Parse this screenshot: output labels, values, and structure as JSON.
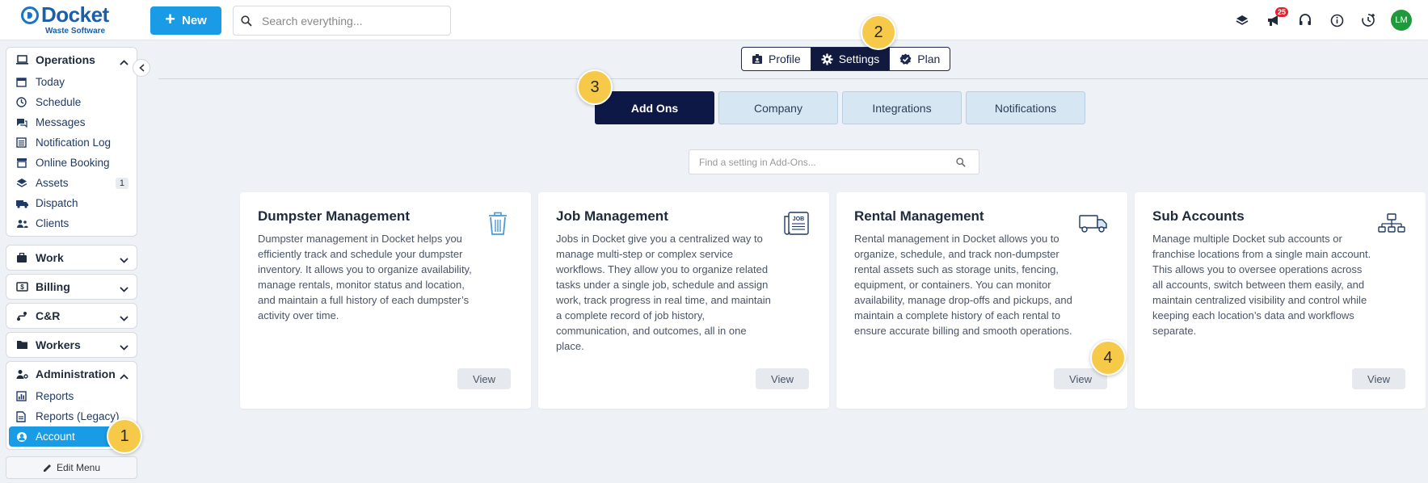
{
  "brand": {
    "name": "Docket",
    "tagline": "Waste Software"
  },
  "header": {
    "new_label": "New",
    "search_placeholder": "Search everything...",
    "notification_count": "25",
    "avatar_initials": "LM"
  },
  "sidebar": {
    "operations": {
      "label": "Operations",
      "items": [
        {
          "label": "Today"
        },
        {
          "label": "Schedule"
        },
        {
          "label": "Messages"
        },
        {
          "label": "Notification Log"
        },
        {
          "label": "Online Booking"
        },
        {
          "label": "Assets",
          "badge": "1"
        },
        {
          "label": "Dispatch"
        },
        {
          "label": "Clients"
        }
      ]
    },
    "sections": [
      {
        "label": "Work"
      },
      {
        "label": "Billing"
      },
      {
        "label": "C&R"
      },
      {
        "label": "Workers"
      }
    ],
    "administration": {
      "label": "Administration",
      "items": [
        {
          "label": "Reports"
        },
        {
          "label": "Reports (Legacy)"
        },
        {
          "label": "Account"
        }
      ]
    },
    "edit_menu_label": "Edit Menu"
  },
  "top_tabs": [
    {
      "label": "Profile"
    },
    {
      "label": "Settings"
    },
    {
      "label": "Plan"
    }
  ],
  "sub_tabs": [
    {
      "label": "Add Ons"
    },
    {
      "label": "Company"
    },
    {
      "label": "Integrations"
    },
    {
      "label": "Notifications"
    }
  ],
  "find_placeholder": "Find a setting in Add-Ons...",
  "cards": [
    {
      "title": "Dumpster Management",
      "description": "Dumpster management in Docket helps you efficiently track and schedule your dumpster inventory. It allows you to organize availability, manage rentals, monitor status and location, and maintain a full history of each dumpster’s activity over time.",
      "icon": "trash-icon",
      "button": "View"
    },
    {
      "title": "Job Management",
      "description": "Jobs in Docket give you a centralized way to manage multi-step or complex service workflows. They allow you to organize related tasks under a single job, schedule and assign work, track progress in real time, and maintain a complete record of job history, communication, and outcomes, all in one place.",
      "icon": "job-document-icon",
      "icon_text": "JOB",
      "button": "View"
    },
    {
      "title": "Rental Management",
      "description": "Rental management in Docket allows you to organize, schedule, and track non-dumpster rental assets such as storage units, fencing, equipment, or containers. You can monitor availability, manage drop-offs and pickups, and maintain a complete history of each rental to ensure accurate billing and smooth operations.",
      "icon": "truck-icon",
      "button": "View"
    },
    {
      "title": "Sub Accounts",
      "description": "Manage multiple Docket sub accounts or franchise locations from a single main account. This allows you to oversee operations across all accounts, switch between them easily, and maintain centralized visibility and control while keeping each location’s data and workflows separate.",
      "icon": "org-chart-icon",
      "button": "View"
    }
  ],
  "steps": [
    "1",
    "2",
    "3",
    "4"
  ],
  "colors": {
    "primary": "#1a9be6",
    "navy": "#0d1846",
    "step_marker": "#f7c948",
    "avatar": "#1e9a3c",
    "badge": "#e0242f"
  }
}
